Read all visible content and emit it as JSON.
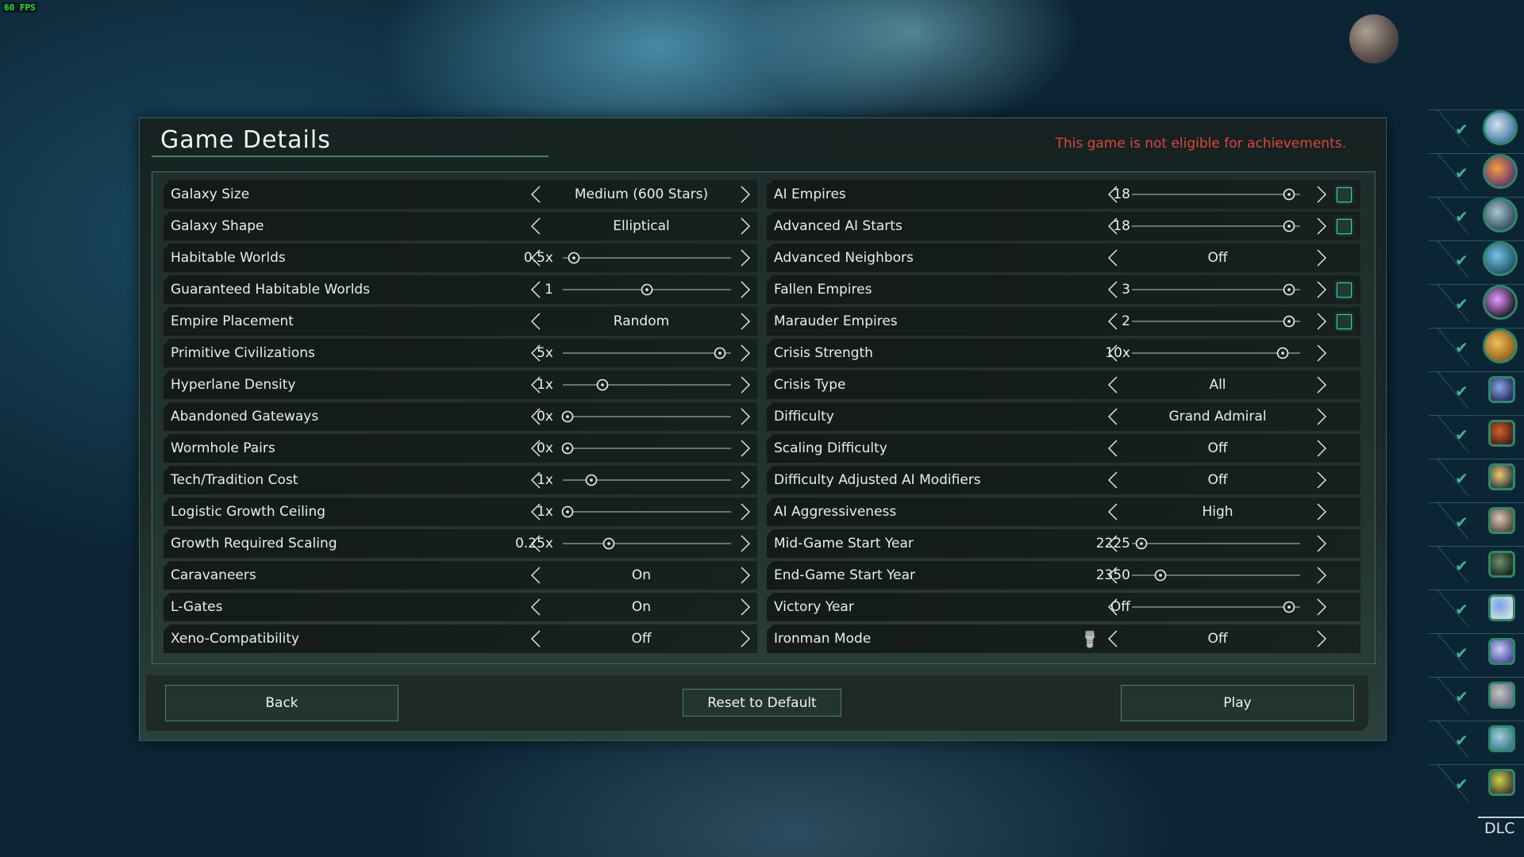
{
  "overlay": {
    "fps": "60 FPS"
  },
  "panel": {
    "title": "Game Details",
    "achievement_notice": "This game is not eligible for achievements.",
    "colors": {
      "accent": "#3fcfae",
      "warning": "#e0453a",
      "check": "#3fb593"
    }
  },
  "left_settings": [
    {
      "label": "Galaxy Size",
      "type": "select",
      "value": "Medium (600 Stars)"
    },
    {
      "label": "Galaxy Shape",
      "type": "select",
      "value": "Elliptical"
    },
    {
      "label": "Habitable Worlds",
      "type": "slider",
      "value": "0.5x",
      "fraction": 0.04
    },
    {
      "label": "Guaranteed Habitable Worlds",
      "type": "slider",
      "value": "1",
      "fraction": 0.5
    },
    {
      "label": "Empire Placement",
      "type": "select",
      "value": "Random"
    },
    {
      "label": "Primitive Civilizations",
      "type": "slider",
      "value": "5x",
      "fraction": 0.96
    },
    {
      "label": "Hyperlane Density",
      "type": "slider",
      "value": "1x",
      "fraction": 0.22
    },
    {
      "label": "Abandoned Gateways",
      "type": "slider",
      "value": "0x",
      "fraction": 0.0
    },
    {
      "label": "Wormhole Pairs",
      "type": "slider",
      "value": "0x",
      "fraction": 0.0
    },
    {
      "label": "Tech/Tradition Cost",
      "type": "slider",
      "value": "1x",
      "fraction": 0.15
    },
    {
      "label": "Logistic Growth Ceiling",
      "type": "slider",
      "value": "1x",
      "fraction": 0.0
    },
    {
      "label": "Growth Required Scaling",
      "type": "slider",
      "value": "0.25x",
      "fraction": 0.26
    },
    {
      "label": "Caravaneers",
      "type": "select",
      "value": "On"
    },
    {
      "label": "L-Gates",
      "type": "select",
      "value": "On"
    },
    {
      "label": "Xeno-Compatibility",
      "type": "select",
      "value": "Off"
    }
  ],
  "right_settings": [
    {
      "label": "AI Empires",
      "type": "slider",
      "value": "18",
      "fraction": 0.96,
      "checkbox": true
    },
    {
      "label": "Advanced AI Starts",
      "type": "slider",
      "value": "18",
      "fraction": 0.96,
      "checkbox": true
    },
    {
      "label": "Advanced Neighbors",
      "type": "select",
      "value": "Off"
    },
    {
      "label": "Fallen Empires",
      "type": "slider",
      "value": "3",
      "fraction": 0.96,
      "checkbox": true
    },
    {
      "label": "Marauder Empires",
      "type": "slider",
      "value": "2",
      "fraction": 0.96,
      "checkbox": true
    },
    {
      "label": "Crisis Strength",
      "type": "slider",
      "value": "10x",
      "fraction": 0.92
    },
    {
      "label": "Crisis Type",
      "type": "select",
      "value": "All"
    },
    {
      "label": "Difficulty",
      "type": "select",
      "value": "Grand Admiral"
    },
    {
      "label": "Scaling Difficulty",
      "type": "select",
      "value": "Off"
    },
    {
      "label": "Difficulty Adjusted AI Modifiers",
      "type": "select",
      "value": "Off"
    },
    {
      "label": "AI Aggressiveness",
      "type": "select",
      "value": "High"
    },
    {
      "label": "Mid-Game Start Year",
      "type": "slider",
      "value": "2225",
      "fraction": 0.03
    },
    {
      "label": "End-Game Start Year",
      "type": "slider",
      "value": "2350",
      "fraction": 0.15
    },
    {
      "label": "Victory Year",
      "type": "slider",
      "value": "Off",
      "fraction": 0.96
    },
    {
      "label": "Ironman Mode",
      "type": "select",
      "value": "Off",
      "icon": "gauntlet-icon"
    }
  ],
  "buttons": {
    "back": "Back",
    "reset": "Reset to Default",
    "play": "Play"
  },
  "dlc": {
    "label": "DLC",
    "items": [
      {
        "name": "storm-dlc-icon",
        "shape": "round",
        "enabled": true,
        "colors": [
          "#cfe3f2",
          "#3d6f9a"
        ]
      },
      {
        "name": "apocalypse-dlc-icon",
        "shape": "round",
        "enabled": true,
        "colors": [
          "#f2a13a",
          "#5b2b78"
        ]
      },
      {
        "name": "federations-dlc-icon",
        "shape": "round",
        "enabled": true,
        "colors": [
          "#a9c3cf",
          "#294556"
        ]
      },
      {
        "name": "megacorp-dlc-icon",
        "shape": "round",
        "enabled": true,
        "colors": [
          "#74c6e6",
          "#1b4a63"
        ]
      },
      {
        "name": "distant-stars-dlc-icon",
        "shape": "round",
        "enabled": true,
        "colors": [
          "#e79bff",
          "#120d1a"
        ]
      },
      {
        "name": "overlord-dlc-icon",
        "shape": "round",
        "enabled": true,
        "colors": [
          "#f2c05a",
          "#8a5512"
        ]
      },
      {
        "name": "humanoids-species-icon",
        "shape": "square",
        "enabled": true,
        "colors": [
          "#8aa8e6",
          "#2a2f66"
        ]
      },
      {
        "name": "lithoids-species-icon",
        "shape": "square",
        "enabled": true,
        "colors": [
          "#d2632c",
          "#4a1e14"
        ]
      },
      {
        "name": "necroids-species-icon",
        "shape": "square",
        "enabled": true,
        "colors": [
          "#f3c969",
          "#2a3a44"
        ]
      },
      {
        "name": "plantoids-species-icon",
        "shape": "square",
        "enabled": true,
        "colors": [
          "#d9c8b8",
          "#5a4a3c"
        ]
      },
      {
        "name": "aquatics-species-icon",
        "shape": "square",
        "enabled": true,
        "colors": [
          "#6f8f6c",
          "#1b2a1f"
        ]
      },
      {
        "name": "toxoids-species-icon",
        "shape": "square",
        "enabled": true,
        "colors": [
          "#6fa4e6",
          "#d7dbe2"
        ]
      },
      {
        "name": "crystal-species-icon",
        "shape": "square",
        "enabled": true,
        "colors": [
          "#c6cff5",
          "#4d4e9c"
        ]
      },
      {
        "name": "arthropoid-species-icon",
        "shape": "square",
        "enabled": true,
        "colors": [
          "#c8c6c2",
          "#6a6f86"
        ]
      },
      {
        "name": "mammalian-species-icon",
        "shape": "square",
        "enabled": true,
        "colors": [
          "#9fd0dc",
          "#3e7b8a"
        ]
      },
      {
        "name": "reptilian-species-icon",
        "shape": "square",
        "enabled": true,
        "colors": [
          "#c8d64a",
          "#4a3d2a"
        ]
      }
    ]
  }
}
